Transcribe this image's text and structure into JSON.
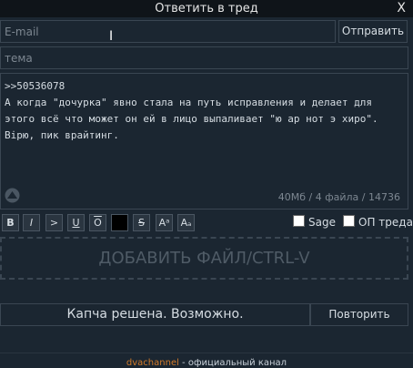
{
  "title": "Ответить в тред",
  "close_label": "X",
  "email": {
    "placeholder": "E-mail"
  },
  "send_label": "Отправить",
  "subject": {
    "placeholder": "тема"
  },
  "message": {
    "text": ">>50536078\nА когда \"дочурка\" явно стала на путь исправления и делает для этого всё что может он ей в лицо выпаливает \"ю ар нот э хиро\". Вірю, пик врайтинг.",
    "counter": "40Мб / 4 файла / 14736"
  },
  "toolbar": {
    "bold": "B",
    "italic": "I",
    "quote": ">",
    "underline": "U",
    "overline": "O",
    "spoiler": " ",
    "strike": "S",
    "sup": "Aᵃ",
    "sub": "Aₐ"
  },
  "options": {
    "sage": "Sage",
    "op": "ОП треда"
  },
  "dropzone": "ДОБАВИТЬ ФАЙЛ/CTRL-V",
  "captcha": {
    "status": "Капча решена. Возможно.",
    "retry": "Повторить"
  },
  "footer": {
    "link": "dvachannel",
    "text": " - официальный канал"
  }
}
